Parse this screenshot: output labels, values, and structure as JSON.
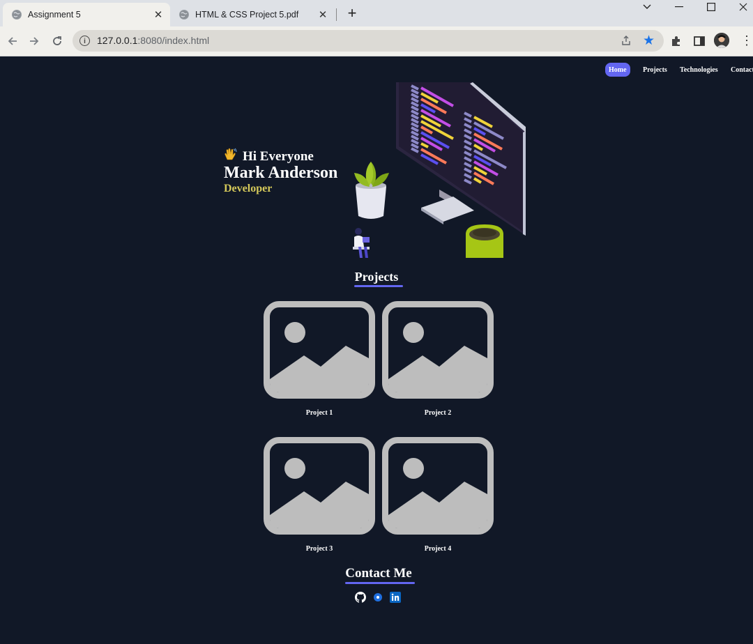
{
  "browser": {
    "tabs": [
      {
        "title": "Assignment 5",
        "active": true
      },
      {
        "title": "HTML & CSS Project 5.pdf",
        "active": false
      }
    ],
    "url_host": "127.0.0.1",
    "url_rest": ":8080/index.html",
    "accent_color": "#1a73e8"
  },
  "nav": {
    "items": [
      {
        "label": "Home",
        "active": true
      },
      {
        "label": "Projects",
        "active": false
      },
      {
        "label": "Technologies",
        "active": false
      },
      {
        "label": "Contact",
        "active": false
      }
    ],
    "active_color": "#6366f1"
  },
  "hero": {
    "wave_icon": "waving-hand-icon",
    "greeting": "Hi Everyone",
    "name": "Mark Anderson",
    "role": "Developer",
    "role_color": "#d4c85a"
  },
  "projects": {
    "title": "Projects",
    "items": [
      {
        "caption": "Project 1",
        "icon": "image-placeholder-icon"
      },
      {
        "caption": "Project 2",
        "icon": "image-placeholder-icon"
      },
      {
        "caption": "Project 3",
        "icon": "image-placeholder-icon"
      },
      {
        "caption": "Project 4",
        "icon": "image-placeholder-icon"
      }
    ]
  },
  "contact": {
    "title": "Contact Me",
    "links": [
      {
        "icon": "github-icon"
      },
      {
        "icon": "website-icon"
      },
      {
        "icon": "linkedin-icon"
      }
    ]
  },
  "colors": {
    "page_bg": "#111827",
    "accent": "#6366f1"
  }
}
